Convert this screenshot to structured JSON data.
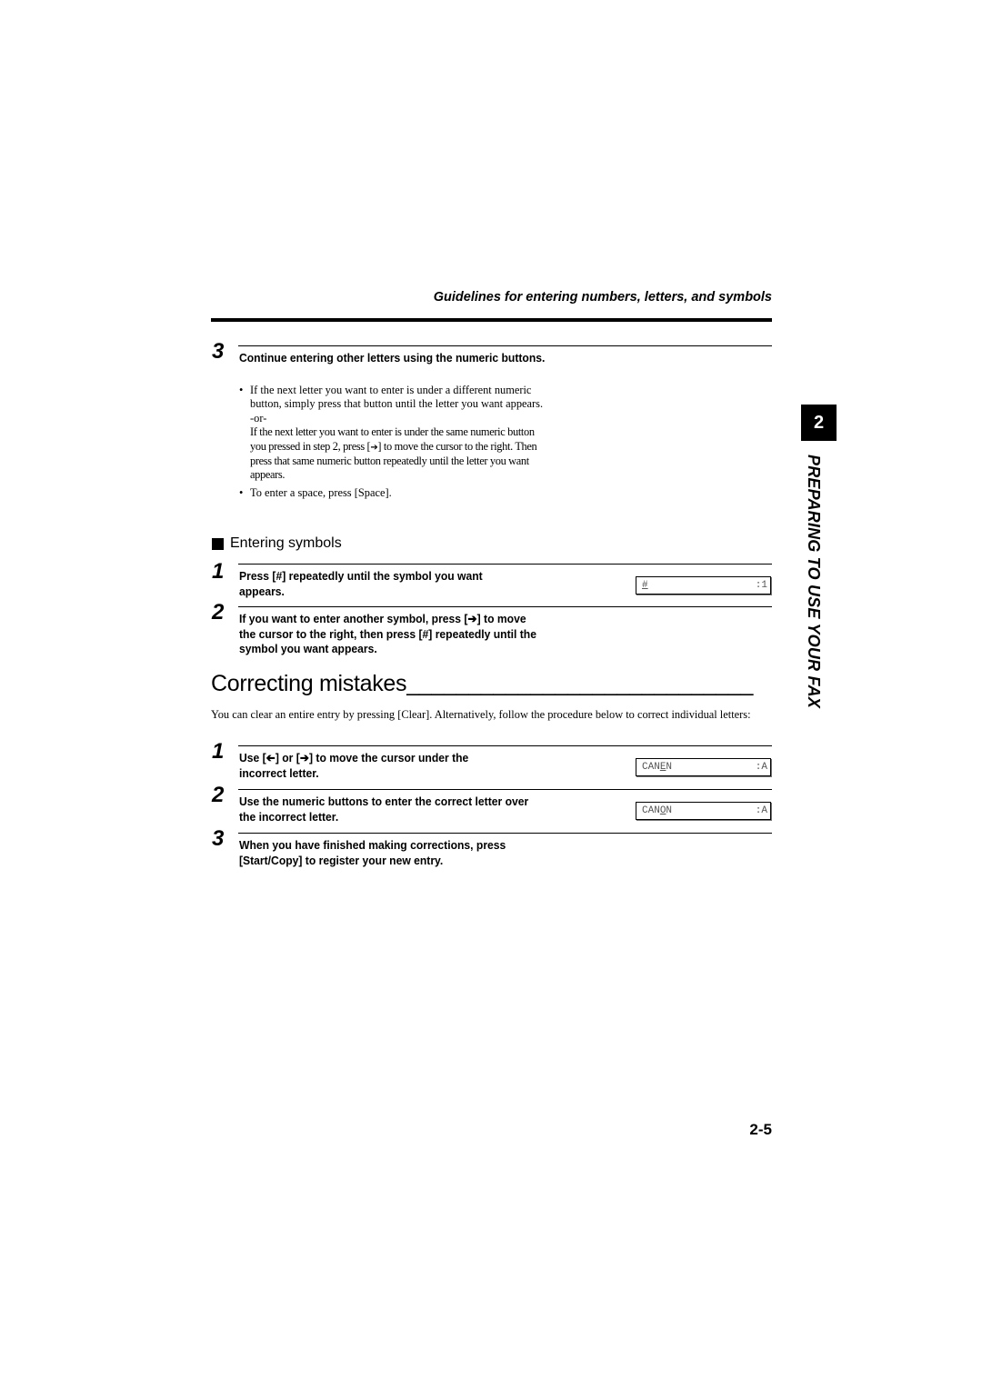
{
  "header": {
    "title": "Guidelines for entering numbers, letters, and symbols"
  },
  "chapter_tab": {
    "number": "2",
    "title": "PREPARING TO USE YOUR FAX"
  },
  "continue_section": {
    "step": {
      "number": "3",
      "text": "Continue entering other letters using the numeric buttons."
    },
    "bullets": [
      {
        "line1": "If the next letter you want to enter is under a different numeric button, simply press that button until the letter you want appears.",
        "or": "-or-",
        "line2_before": "If the next letter you want to enter is under the same numeric button you pressed in step 2, press [",
        "line2_icon": "right-arrow-icon",
        "line2_after": "] to move the cursor to the right. Then press that same numeric button repeatedly until the letter you want appears."
      },
      {
        "text": "To enter a space, press [Space]."
      }
    ]
  },
  "entering_symbols": {
    "heading": "Entering symbols",
    "steps": [
      {
        "number": "1",
        "text": "Press [#] repeatedly until the symbol you want appears.",
        "lcd": {
          "cursor_char": "#",
          "before": "",
          "after": "",
          "right": ":1"
        }
      },
      {
        "number": "2",
        "text_before": "If you want to enter another symbol, press [",
        "icon": "right-arrow-icon",
        "text_after": "] to move the cursor to the right, then press [#] repeatedly until the symbol you want appears."
      }
    ]
  },
  "correcting_mistakes": {
    "title": "Correcting mistakes",
    "title_trail": "____________________________",
    "intro": "You can clear an entire entry by pressing [Clear]. Alternatively, follow the procedure below to correct individual letters:",
    "steps": [
      {
        "number": "1",
        "text_part1": "Use [",
        "icon1": "left-arrow-icon",
        "text_part2": "] or [",
        "icon2": "right-arrow-icon",
        "text_part3": "] to move the cursor under the incorrect letter.",
        "lcd": {
          "before": "CAN",
          "cursor_char": "E",
          "after": "N",
          "right": ":A"
        }
      },
      {
        "number": "2",
        "text": "Use the numeric buttons to enter the correct letter over the incorrect letter.",
        "lcd": {
          "before": "CAN",
          "cursor_char": "O",
          "after": "N",
          "right": ":A"
        }
      },
      {
        "number": "3",
        "text": "When you have finished making corrections, press [Start/Copy] to register your new entry."
      }
    ]
  },
  "footer": {
    "page_number": "2-5"
  }
}
